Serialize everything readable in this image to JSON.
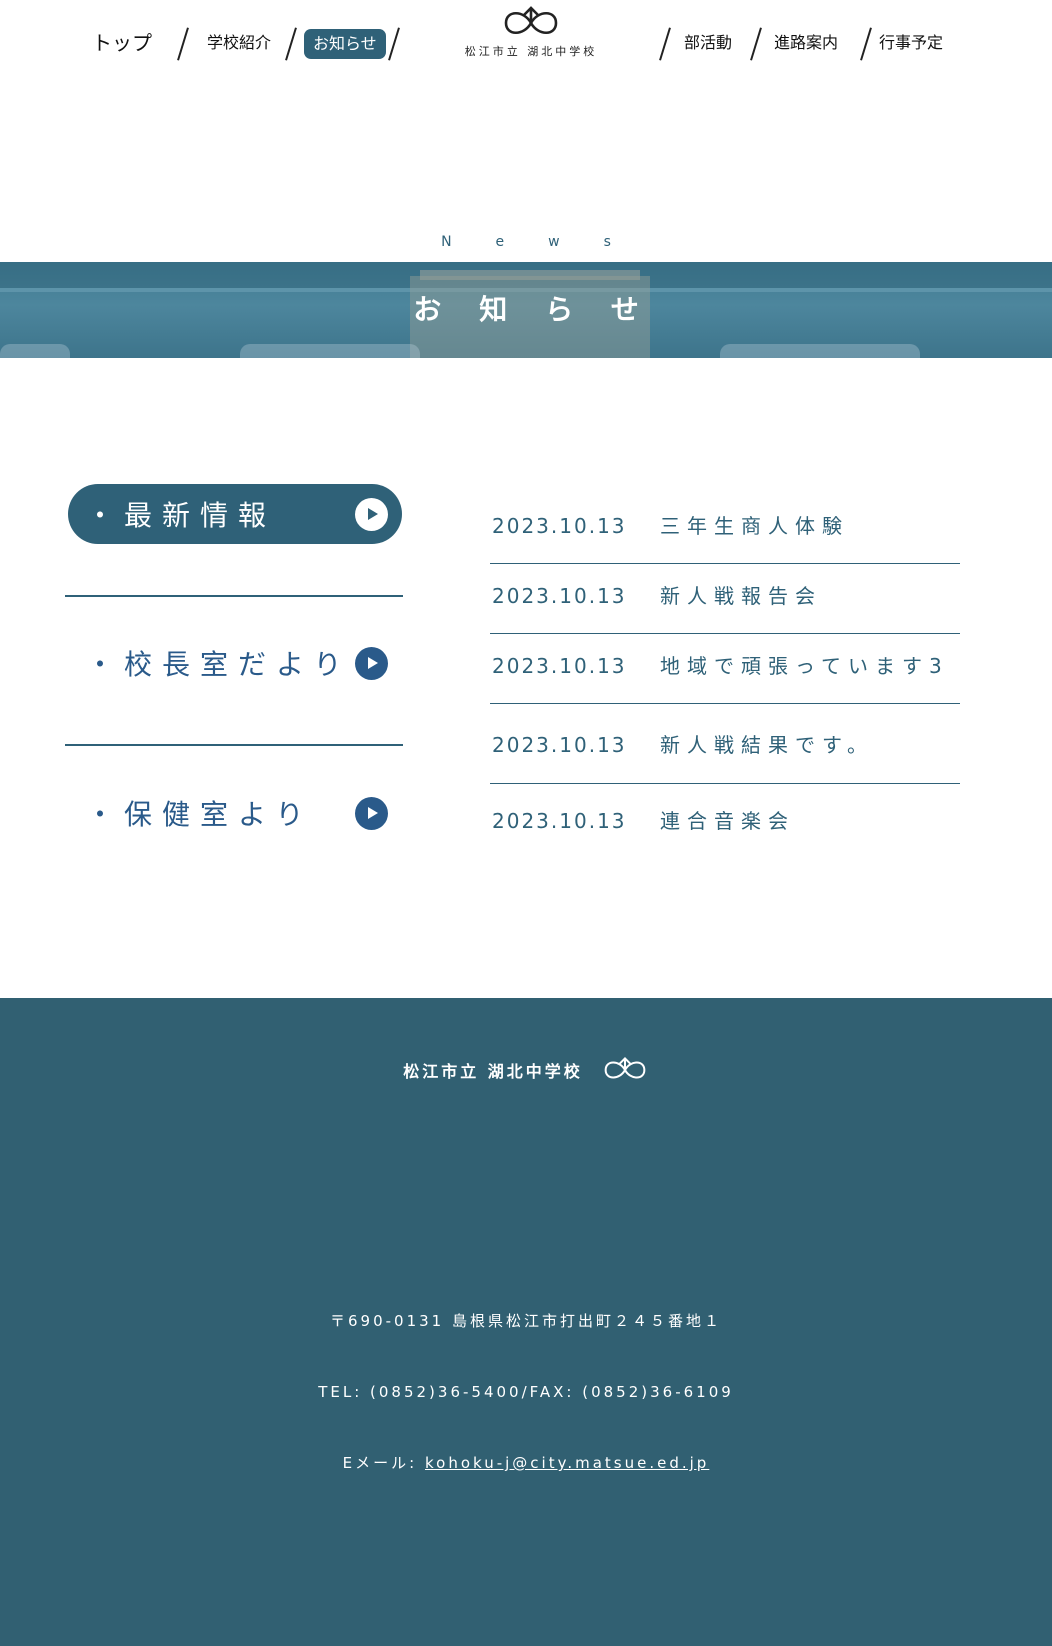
{
  "header": {
    "nav_left": [
      {
        "label": "トップ"
      },
      {
        "label": "学校紹介"
      },
      {
        "label": "お知らせ"
      }
    ],
    "nav_right": [
      {
        "label": "部活動"
      },
      {
        "label": "進路案内"
      },
      {
        "label": "行事予定"
      }
    ],
    "active_nav": "お知らせ",
    "logo_text": "松江市立 湖北中学校"
  },
  "hero": {
    "subtitle": "News",
    "title": "お知らせ"
  },
  "categories": [
    {
      "label": "・最新情報",
      "active": true
    },
    {
      "label": "・校長室だより",
      "active": false
    },
    {
      "label": "・保健室より",
      "active": false
    }
  ],
  "news": [
    {
      "date": "2023.10.13",
      "title": "三年生商人体験"
    },
    {
      "date": "2023.10.13",
      "title": "新人戦報告会"
    },
    {
      "date": "2023.10.13",
      "title": "地域で頑張っています3"
    },
    {
      "date": "2023.10.13",
      "title": "新人戦結果です。"
    },
    {
      "date": "2023.10.13",
      "title": "連合音楽会"
    }
  ],
  "footer": {
    "school_name": "松江市立 湖北中学校",
    "address": "〒690-0131 島根県松江市打出町２４５番地１",
    "phone_fax": "TEL: (0852)36-5400/FAX: (0852)36-6109",
    "email_label": "Eメール: ",
    "email": "kohoku-j@city.matsue.ed.jp"
  },
  "colors": {
    "primary": "#2f6178",
    "category_text": "#2a5a8a",
    "footer_bg": "#316072"
  },
  "icons": [
    "school-logo-icon",
    "play-arrow-icon"
  ]
}
